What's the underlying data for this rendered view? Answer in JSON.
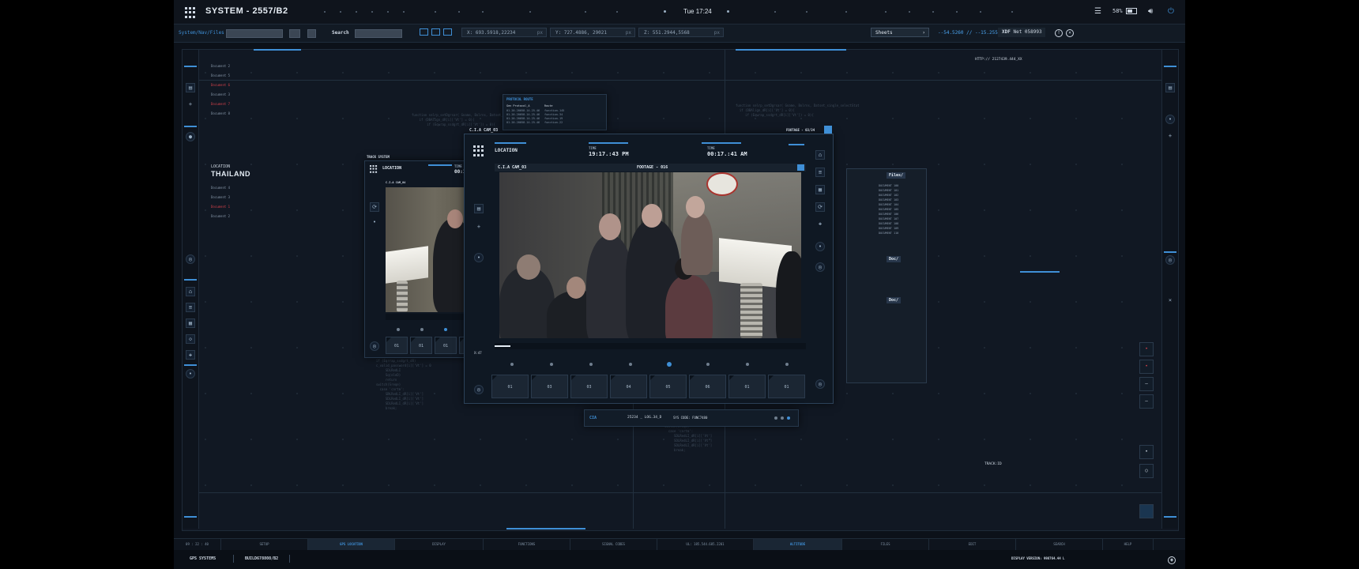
{
  "topbar": {
    "title": "SYSTEM - 2557/B2",
    "day": "Tue",
    "time": "17:24",
    "battery": "58%"
  },
  "toolbar": {
    "breadcrumb": "System/Nav/Files",
    "search_label": "Search",
    "coord_x": "X: 693.5918,22234",
    "coord_y": "Y: 727.4886, 29021",
    "coord_z": "Z: 551.2944,5568",
    "unit": "px",
    "sheets_label": "Sheets",
    "latlon": "--54.5260 // --15.2551",
    "xdf_label": "XDF",
    "xdf_value": "Net 058993"
  },
  "left_panel": {
    "location_label": "LOCATION",
    "location_value": "THAILAND",
    "docs_top": [
      {
        "name": "Document 2",
        "red": false
      },
      {
        "name": "Document 5",
        "red": false
      },
      {
        "name": "Document 6",
        "red": true
      },
      {
        "name": "Document 3",
        "red": false
      },
      {
        "name": "Document 7",
        "red": true
      },
      {
        "name": "Document 8",
        "red": false
      }
    ],
    "docs_mid": [
      {
        "name": "Document 4",
        "red": false
      },
      {
        "name": "Document 3",
        "red": false
      },
      {
        "name": "Document 1",
        "red": true
      },
      {
        "name": "Document 2",
        "red": false
      }
    ]
  },
  "right_panel": {
    "http": "HTTP:// 2127439.444_XX",
    "track": "TRACK:ID"
  },
  "protocol": {
    "title": "PROTOCOL ROUTE",
    "col1": "Gen Protocol_A",
    "col2": "Route",
    "rows": [
      "01.20.20058.14.25.46",
      "01.20.20058.14.25.46",
      "01.20.20058.14.25.46",
      "01.20.20058.14.25.46"
    ],
    "route_rows": [
      "function.145",
      "function.34",
      "function.19",
      "function.22"
    ]
  },
  "track_window": {
    "title": "TRACK SYSTEM",
    "location_label": "LOCATION",
    "time_label": "TIME",
    "time_value": "00:17",
    "cam_label": "C.I.A CAM_04",
    "thumbs": [
      "01",
      "01",
      "01",
      "01"
    ]
  },
  "main_window": {
    "header": "C.I.A CAM_03",
    "location_label": "LOCATION",
    "time_label_1": "TIME",
    "time_value_1": "19:17.:43 PM",
    "time_label_2": "TIME",
    "time_value_2": "00:17.:41 AM",
    "footage_header": "FOOTAGE - 03/34",
    "cam_label": "C.I.A CAM_03",
    "footage_label": "FOOTAGE - 016",
    "thumbs": [
      "01",
      "03",
      "03",
      "04",
      "05",
      "06",
      "01",
      "01"
    ],
    "progress": 0.05
  },
  "files_panel": {
    "title": "Files/",
    "doc1": "Doc/",
    "doc2": "Doc/"
  },
  "cia_strip": {
    "label": "CIA",
    "log": "25234 _ LOG.34_D",
    "sys": "SYS CODE: FUNC7480"
  },
  "bottombar": {
    "items": [
      {
        "label": "09 : 22 : 40",
        "active": false
      },
      {
        "label": "SETUP",
        "active": false
      },
      {
        "label": "GPS LOCATION",
        "active": true
      },
      {
        "label": "DISPLAY",
        "active": false
      },
      {
        "label": "FUNCTIONS",
        "active": false
      },
      {
        "label": "SIGNAL CODES",
        "active": false
      },
      {
        "label": "UL: 185.544.685.2201",
        "active": false
      },
      {
        "label": "ALTITUDE",
        "active": true
      },
      {
        "label": "FILES",
        "active": false
      },
      {
        "label": "EDIT",
        "active": false
      },
      {
        "label": "SEARCH",
        "active": false
      },
      {
        "label": "HELP",
        "active": false
      }
    ]
  },
  "footer": {
    "gps": "GPS SYSTEMS",
    "build": "BUILD678808/B2",
    "display_version": "DISPLAY VERSION: 998764.44 L"
  },
  "colors": {
    "accent": "#3f8fd6",
    "alert": "#d0404a",
    "bg": "#0c1119"
  }
}
